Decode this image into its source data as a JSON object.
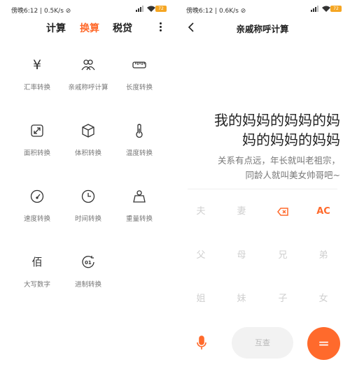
{
  "left": {
    "status": {
      "time": "傍晚6:12 | 0.5K/s ⊘",
      "battery": "72"
    },
    "tabs": [
      "计算",
      "换算",
      "税贷"
    ],
    "active_tab": 1,
    "items": [
      {
        "label": "汇率转换",
        "icon": "yuan-icon",
        "glyph": "¥"
      },
      {
        "label": "亲戚称呼计算",
        "icon": "people-icon"
      },
      {
        "label": "长度转换",
        "icon": "ruler-icon"
      },
      {
        "label": "面积转换",
        "icon": "area-icon"
      },
      {
        "label": "体积转换",
        "icon": "cube-icon"
      },
      {
        "label": "温度转换",
        "icon": "thermometer-icon"
      },
      {
        "label": "速度转换",
        "icon": "speedometer-icon"
      },
      {
        "label": "时间转换",
        "icon": "clock-icon"
      },
      {
        "label": "重量转换",
        "icon": "weight-icon"
      },
      {
        "label": "大写数字",
        "icon": "bai-icon",
        "glyph": "佰"
      },
      {
        "label": "进制转换",
        "icon": "binary-icon"
      }
    ]
  },
  "right": {
    "status": {
      "time": "傍晚6:12 | 0.6K/s ⊘",
      "battery": "72"
    },
    "title": "亲戚称呼计算",
    "relation_line1": "我的妈妈的妈妈的妈",
    "relation_line2": "妈的妈妈的妈妈",
    "result_line1": "关系有点远，年长就叫老祖宗，",
    "result_line2": "同龄人就叫美女帅哥吧~",
    "keys": [
      [
        "夫",
        "妻",
        "",
        "AC"
      ],
      [
        "父",
        "母",
        "兄",
        "弟"
      ],
      [
        "姐",
        "妹",
        "子",
        "女"
      ]
    ],
    "check_label": "互查",
    "equals_label": "="
  },
  "colors": {
    "accent": "#ff6a2c",
    "disabled": "#cfcfcf",
    "battery": "#f5a623"
  }
}
